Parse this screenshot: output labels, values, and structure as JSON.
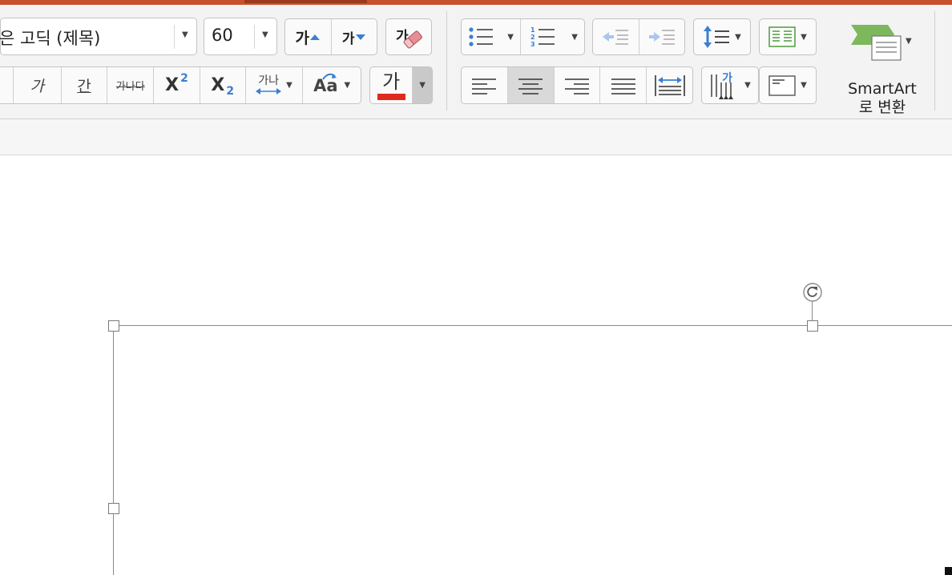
{
  "font": {
    "name": "은 고딕 (제목)",
    "size": "60"
  },
  "buttons": {
    "grow_font": "가",
    "shrink_font": "가",
    "clear_format": "가",
    "italic": "가",
    "underline": "간",
    "strikethrough": "가나다",
    "superscript_base": "X",
    "superscript_exp": "2",
    "subscript_base": "X",
    "subscript_exp": "2",
    "char_spacing": "가나",
    "change_case": "Aa",
    "font_color": "가",
    "text_direction": "가"
  },
  "paragraph": {
    "numbering_digits": [
      "1",
      "2",
      "3"
    ]
  },
  "smartart": {
    "line1": "SmartArt",
    "line2": "로 변환"
  },
  "colors": {
    "accent": "#c9502c",
    "font_color_bar": "#e02a1e",
    "icon_blue": "#3a7fd0",
    "smartart_green": "#7db85c"
  }
}
